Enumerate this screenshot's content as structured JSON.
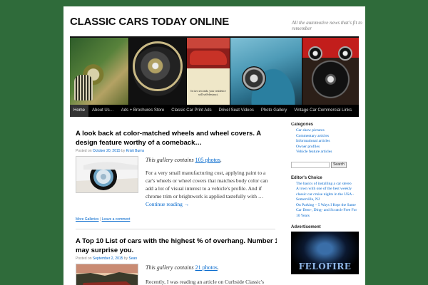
{
  "header": {
    "title": "CLASSIC CARS TODAY ONLINE",
    "tagline": "All the automotive news that's fit to remember"
  },
  "banner": {
    "ad_text": "In two seconds, your residence will self-destruct."
  },
  "nav": {
    "items": [
      "Home",
      "About Us…",
      "Ads + Brochures Store",
      "Classic Car Print Ads",
      "Drivel Seat Videos",
      "Photo Gallery",
      "Vintage Car Commercial Links"
    ],
    "active": "Home"
  },
  "posts": [
    {
      "title": "A look back at color-matched wheels and wheel covers. A design feature worthy of a comeback…",
      "meta_posted": "Posted on",
      "meta_date": "October 20, 2015",
      "meta_by": "by",
      "meta_author": "Kristi Burns",
      "gallery_prefix": "This gallery contains",
      "gallery_count": "105 photos",
      "excerpt": "For a very small manufacturing cost, applying paint to a car's wheels or wheel covers that matches body color can add a lot of visual interest to a vehicle's profile.  And if chrome trim or brightwork is applied tastefully with …",
      "continue": "Continue reading →",
      "footer_link1": "More Galleries",
      "footer_sep": "|",
      "footer_link2": "Leave a comment"
    },
    {
      "title": "A Top 10 List of cars with the highest % of overhang. Number 1 may surprise you.",
      "meta_posted": "Posted on",
      "meta_date": "September 2, 2015",
      "meta_by": "by",
      "meta_author": "Sean",
      "gallery_prefix": "This gallery contains",
      "gallery_count": "21 photos",
      "excerpt": "Recently, I was reading an article on Curbside Classic's website titled \"Design Analysis: Did The"
    }
  ],
  "sidebar": {
    "categories_title": "Categories",
    "categories": [
      "Car show pictures",
      "Commentary articles",
      "Informational articles",
      "Owner profiles",
      "Vehicle feature articles"
    ],
    "search_button": "Search",
    "search_placeholder": "",
    "editors_title": "Editor's Choice",
    "editors": [
      "The basics of installing a car stereo",
      "A town with one of the best weekly classic car cruise nights in the USA - Somerville, NJ",
      "On Parking – 5 Ways I Kept the Same Car Dent-, Ding- and Scratch-Free For 10 Years"
    ],
    "ad_title": "Advertisement",
    "ad_logo": "FELOFIRE"
  }
}
